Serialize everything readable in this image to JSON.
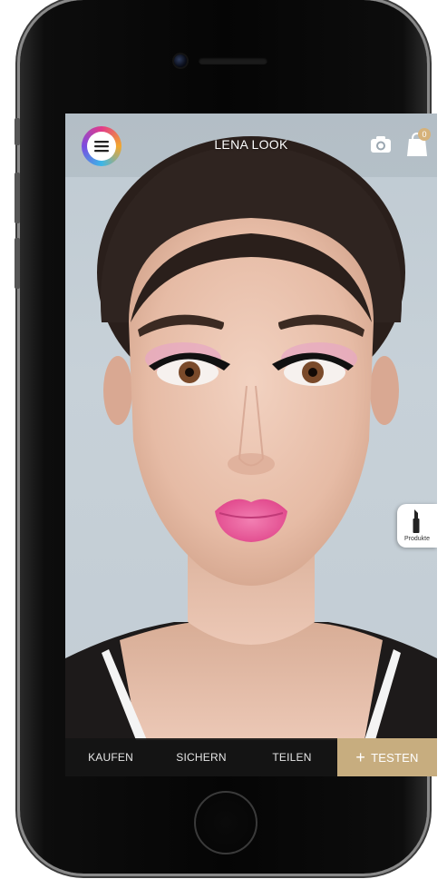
{
  "app": {
    "title": "LENA LOOK",
    "cart_count": "0"
  },
  "icons": {
    "menu": "hamburger-menu-icon",
    "camera": "camera-icon",
    "cart": "shopping-bag-icon",
    "lipstick": "lipstick-icon",
    "plus": "plus-icon"
  },
  "products_button": {
    "label": "Produkte"
  },
  "bottom_bar": {
    "kaufen": "KAUFEN",
    "sichern": "SICHERN",
    "teilen": "TEILEN",
    "testen_plus": "+",
    "testen": "TESTEN"
  },
  "colors": {
    "accent_gold": "#c7ad7f",
    "bar_dark": "#141414",
    "lip_pink": "#e9559a"
  }
}
